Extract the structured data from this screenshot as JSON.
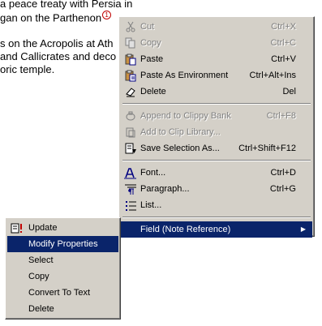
{
  "document": {
    "line1": "a peace treaty with Persia in",
    "line2": "gan on the Parthenon",
    "footnote_ref": "1",
    "line3": "s on the Acropolis at Ath",
    "line4": "and Callicrates and deco",
    "line5": "oric temple."
  },
  "context_menu": {
    "items": [
      {
        "label": "Cut",
        "shortcut": "Ctrl+X",
        "icon": "scissors-icon",
        "enabled": false
      },
      {
        "label": "Copy",
        "shortcut": "Ctrl+C",
        "icon": "copy-icon",
        "enabled": false
      },
      {
        "label": "Paste",
        "shortcut": "Ctrl+V",
        "icon": "paste-icon",
        "enabled": true
      },
      {
        "label": "Paste As Environment",
        "shortcut": "Ctrl+Alt+Ins",
        "icon": "paste-environment-icon",
        "enabled": true
      },
      {
        "label": "Delete",
        "shortcut": "Del",
        "icon": "eraser-icon",
        "enabled": true
      },
      {
        "label": "Append to Clippy Bank",
        "shortcut": "Ctrl+F8",
        "icon": "clippy-bank-icon",
        "enabled": false
      },
      {
        "label": "Add to Clip Library...",
        "shortcut": "",
        "icon": "clip-library-icon",
        "enabled": false
      },
      {
        "label": "Save Selection As...",
        "shortcut": "Ctrl+Shift+F12",
        "icon": "save-selection-icon",
        "enabled": true
      },
      {
        "label": "Font...",
        "shortcut": "Ctrl+D",
        "icon": "font-icon",
        "enabled": true
      },
      {
        "label": "Paragraph...",
        "shortcut": "Ctrl+G",
        "icon": "paragraph-icon",
        "enabled": true
      },
      {
        "label": "List...",
        "shortcut": "",
        "icon": "list-icon",
        "enabled": true
      },
      {
        "label": "Field (Note Reference)",
        "shortcut": "",
        "icon": "",
        "enabled": true,
        "submenu": true
      }
    ]
  },
  "submenu": {
    "items": [
      {
        "label": "Update",
        "icon": "update-field-icon"
      },
      {
        "label": "Modify Properties",
        "icon": ""
      },
      {
        "label": "Select",
        "icon": ""
      },
      {
        "label": "Copy",
        "icon": ""
      },
      {
        "label": "Convert To Text",
        "icon": ""
      },
      {
        "label": "Delete",
        "icon": ""
      }
    ]
  },
  "colors": {
    "menu_bg": "#d4d0c8",
    "highlight": "#0a246a",
    "disabled_text": "#808080",
    "footnote_mark": "#c00000"
  }
}
